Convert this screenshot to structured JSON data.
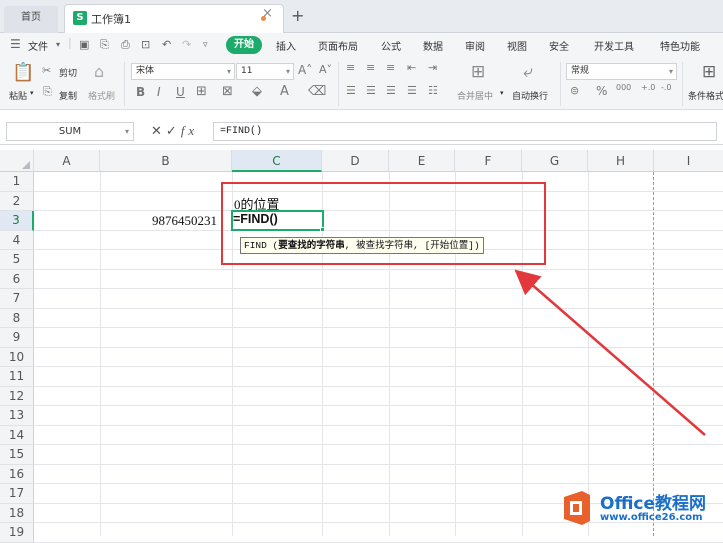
{
  "tabs": {
    "home": "首页",
    "workbook": "工作簿1",
    "close": "×",
    "add": "+"
  },
  "menu": {
    "file": "文件",
    "start": "开始",
    "items": [
      "插入",
      "页面布局",
      "公式",
      "数据",
      "审阅",
      "视图",
      "安全",
      "开发工具",
      "特色功能"
    ]
  },
  "ribbon": {
    "paste": "粘贴",
    "cut": "剪切",
    "copy": "复制",
    "format_painter": "格式刷",
    "font_name": "宋体",
    "font_size": "11",
    "merge_center": "合并居中",
    "wrap_text": "自动换行",
    "number_format": "常规",
    "conditional_format": "条件格式"
  },
  "formula_bar": {
    "name_box": "SUM",
    "fx": "fx",
    "formula": "=FIND()"
  },
  "columns": [
    "A",
    "B",
    "C",
    "D",
    "E",
    "F",
    "G",
    "H",
    "I"
  ],
  "selected_column": "C",
  "rows": [
    "1",
    "2",
    "3",
    "4",
    "5",
    "6",
    "7",
    "8",
    "9",
    "10",
    "11",
    "12",
    "13",
    "14",
    "15",
    "16",
    "17",
    "18",
    "19"
  ],
  "selected_row": "3",
  "cells": {
    "C2": "0的位置",
    "B3": "9876450231",
    "C3": "=FIND()"
  },
  "tooltip": {
    "func": "FIND",
    "arg1": "要查找的字符串",
    "arg2": "被查找字符串",
    "arg3": "[开始位置]"
  },
  "watermark": {
    "title": "Office教程网",
    "url": "www.office26.com"
  },
  "colors": {
    "accent": "#1dab6b",
    "highlight": "#e2383c",
    "watermark": "#1a6fc8"
  }
}
